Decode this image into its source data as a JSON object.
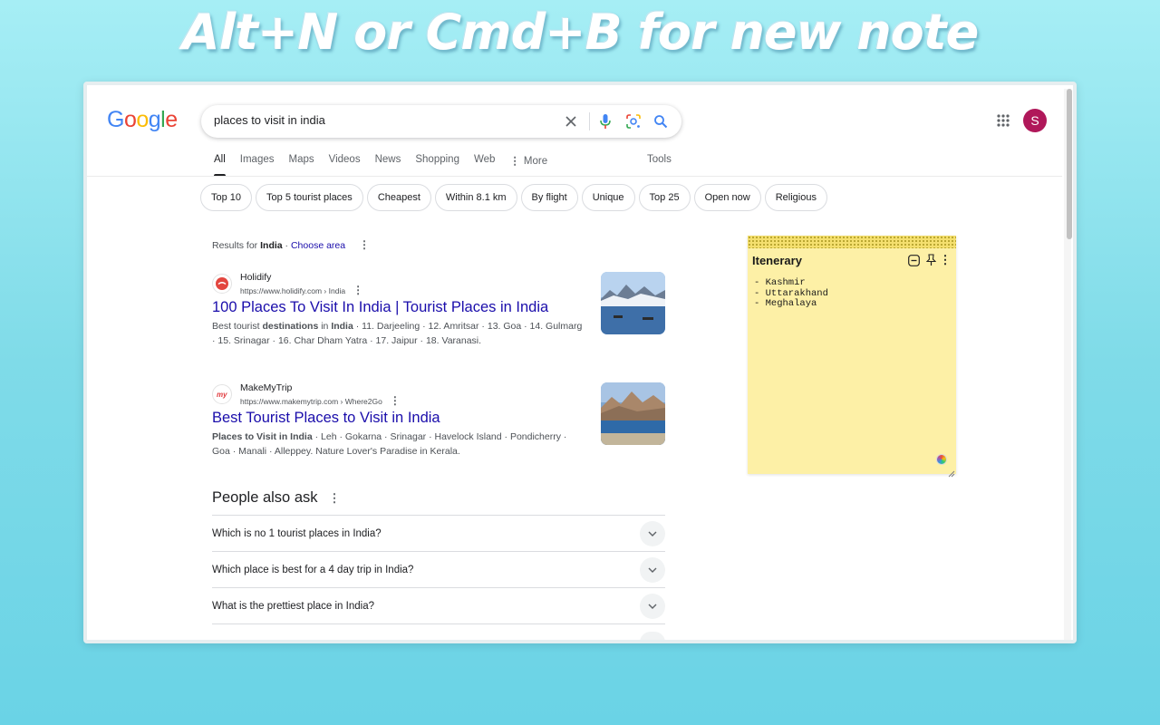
{
  "banner": {
    "text": "Alt+N or Cmd+B for new note"
  },
  "google": {
    "logo_letters": [
      "G",
      "o",
      "o",
      "g",
      "l",
      "e"
    ],
    "logo_colors": [
      "#4285F4",
      "#EA4335",
      "#FBBC05",
      "#4285F4",
      "#34A853",
      "#EA4335"
    ],
    "search_value": "places to visit in india",
    "avatar_letter": "S",
    "avatar_color": "#b0185a"
  },
  "tabs": [
    {
      "label": "All",
      "active": true
    },
    {
      "label": "Images"
    },
    {
      "label": "Maps"
    },
    {
      "label": "Videos"
    },
    {
      "label": "News"
    },
    {
      "label": "Shopping"
    },
    {
      "label": "Web"
    },
    {
      "label": "More",
      "icon": "kebab-icon"
    }
  ],
  "tools_label": "Tools",
  "chips": [
    "Top 10",
    "Top 5 tourist places",
    "Cheapest",
    "Within 8.1 km",
    "By flight",
    "Unique",
    "Top 25",
    "Open now",
    "Religious"
  ],
  "results_for": {
    "prefix": "Results for",
    "place": "India",
    "separator": "·",
    "link": "Choose area"
  },
  "results": [
    {
      "site": "Holidify",
      "url": "https://www.holidify.com › India",
      "title": "100 Places To Visit In India | Tourist Places in India",
      "snippet_parts": [
        "Best tourist ",
        "destinations",
        " in ",
        "India",
        " · 11. Darjeeling · 12. Amritsar · 13. Goa · 14. Gulmarg · 15. Srinagar · 16. Char Dham Yatra · 17. Jaipur · 18. Varanasi."
      ]
    },
    {
      "site": "MakeMyTrip",
      "url": "https://www.makemytrip.com › Where2Go",
      "title": "Best Tourist Places to Visit in India",
      "snippet_parts": [
        "Places to Visit in India",
        " · Leh · Gokarna · Srinagar · Havelock Island · Pondicherry · Goa · Manali · Alleppey. Nature Lover's Paradise in Kerala."
      ]
    }
  ],
  "people_also_ask": {
    "title": "People also ask",
    "questions": [
      "Which is no 1 tourist places in India?",
      "Which place is best for a 4 day trip in India?",
      "What is the prettiest place in India?"
    ]
  },
  "note": {
    "title": "Itenerary",
    "body": "- Kashmir\n- Uttarakhand\n- Meghalaya",
    "background": "#fdf0a6"
  }
}
